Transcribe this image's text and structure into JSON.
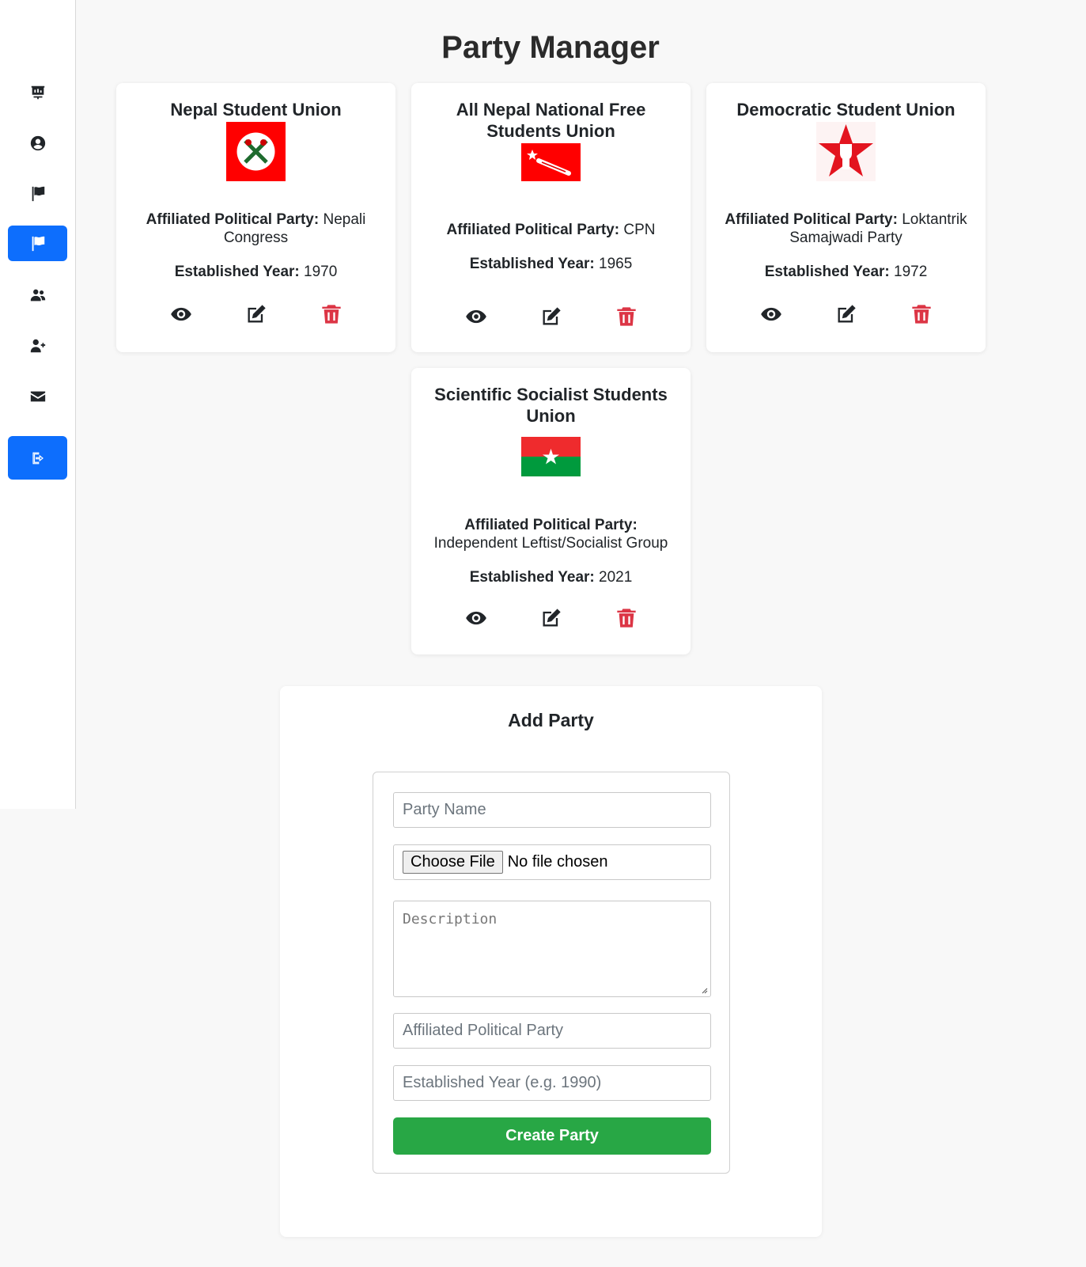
{
  "title": "Party Manager",
  "sidebar": {
    "items": [
      {
        "icon": "presentation-icon"
      },
      {
        "icon": "user-circle-icon"
      },
      {
        "icon": "flag-icon"
      },
      {
        "icon": "flag-icon",
        "active": true
      },
      {
        "icon": "users-icon"
      },
      {
        "icon": "user-plus-icon"
      },
      {
        "icon": "envelope-icon"
      },
      {
        "icon": "logout-icon"
      }
    ]
  },
  "labels": {
    "affiliated": "Affiliated Political Party:",
    "established": "Established Year:"
  },
  "parties": [
    {
      "name": "Nepal Student Union",
      "affiliated": " Nepali Congress",
      "year": " 1970"
    },
    {
      "name": "All Nepal National Free Students Union",
      "affiliated": " CPN",
      "year": " 1965"
    },
    {
      "name": "Democratic Student Union",
      "affiliated": " Loktantrik Samajwadi Party",
      "year": " 1972"
    },
    {
      "name": "Scientific Socialist Students Union",
      "affiliated": " Independent Leftist/Socialist Group",
      "year": " 2021"
    }
  ],
  "form": {
    "title": "Add Party",
    "name_placeholder": "Party Name",
    "file_button": "Choose File",
    "file_status": "No file chosen",
    "description_placeholder": "Description",
    "affiliated_placeholder": "Affiliated Political Party",
    "year_placeholder": "Established Year (e.g. 1990)",
    "submit": "Create Party"
  },
  "colors": {
    "primary": "#0d6efd",
    "danger": "#dc3545",
    "success": "#28a745"
  }
}
